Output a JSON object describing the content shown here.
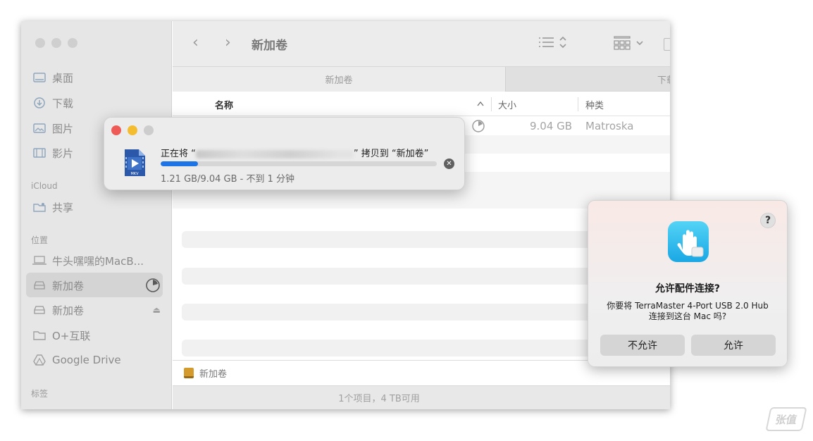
{
  "sidebar": {
    "favorites": [
      {
        "label": "桌面",
        "icon": "desktop-icon"
      },
      {
        "label": "下载",
        "icon": "download-icon"
      },
      {
        "label": "图片",
        "icon": "photo-icon"
      },
      {
        "label": "影片",
        "icon": "film-icon"
      }
    ],
    "icloud_heading": "iCloud",
    "icloud_items": [
      {
        "label": "共享",
        "icon": "shared-folder-icon"
      }
    ],
    "locations_heading": "位置",
    "locations": [
      {
        "label": "牛头嘿嘿的MacB...",
        "icon": "laptop-icon"
      },
      {
        "label": "新加卷",
        "icon": "drive-icon"
      },
      {
        "label": "新加卷",
        "icon": "drive-icon"
      },
      {
        "label": "O+互联",
        "icon": "folder-icon"
      },
      {
        "label": "Google Drive",
        "icon": "google-drive-icon"
      }
    ],
    "tags_heading": "标签"
  },
  "toolbar": {
    "title": "新加卷",
    "back": "‹",
    "forward": "›"
  },
  "tabs": [
    {
      "label": "新加卷"
    },
    {
      "label": "下载"
    }
  ],
  "columns": {
    "name": "名称",
    "size": "大小",
    "kind": "种类"
  },
  "files": [
    {
      "size": "9.04 GB",
      "kind": "Matroska"
    }
  ],
  "pathbar": {
    "label": "新加卷"
  },
  "statusbar": {
    "text": "1个项目，4 TB可用"
  },
  "copy_progress": {
    "prefix": "正在将 “",
    "suffix": "” 拷贝到 “新加卷”",
    "icon_label": "MKV",
    "progress": 0.134,
    "detail": "1.21 GB/9.04 GB - 不到 1 分钟"
  },
  "dialog": {
    "help": "?",
    "title": "允许配件连接?",
    "message_line1": "你要将 TerraMaster 4-Port USB 2.0 Hub",
    "message_line2": "连接到这台 Mac 吗?",
    "deny": "不允许",
    "allow": "允许"
  },
  "watermark": "张值"
}
